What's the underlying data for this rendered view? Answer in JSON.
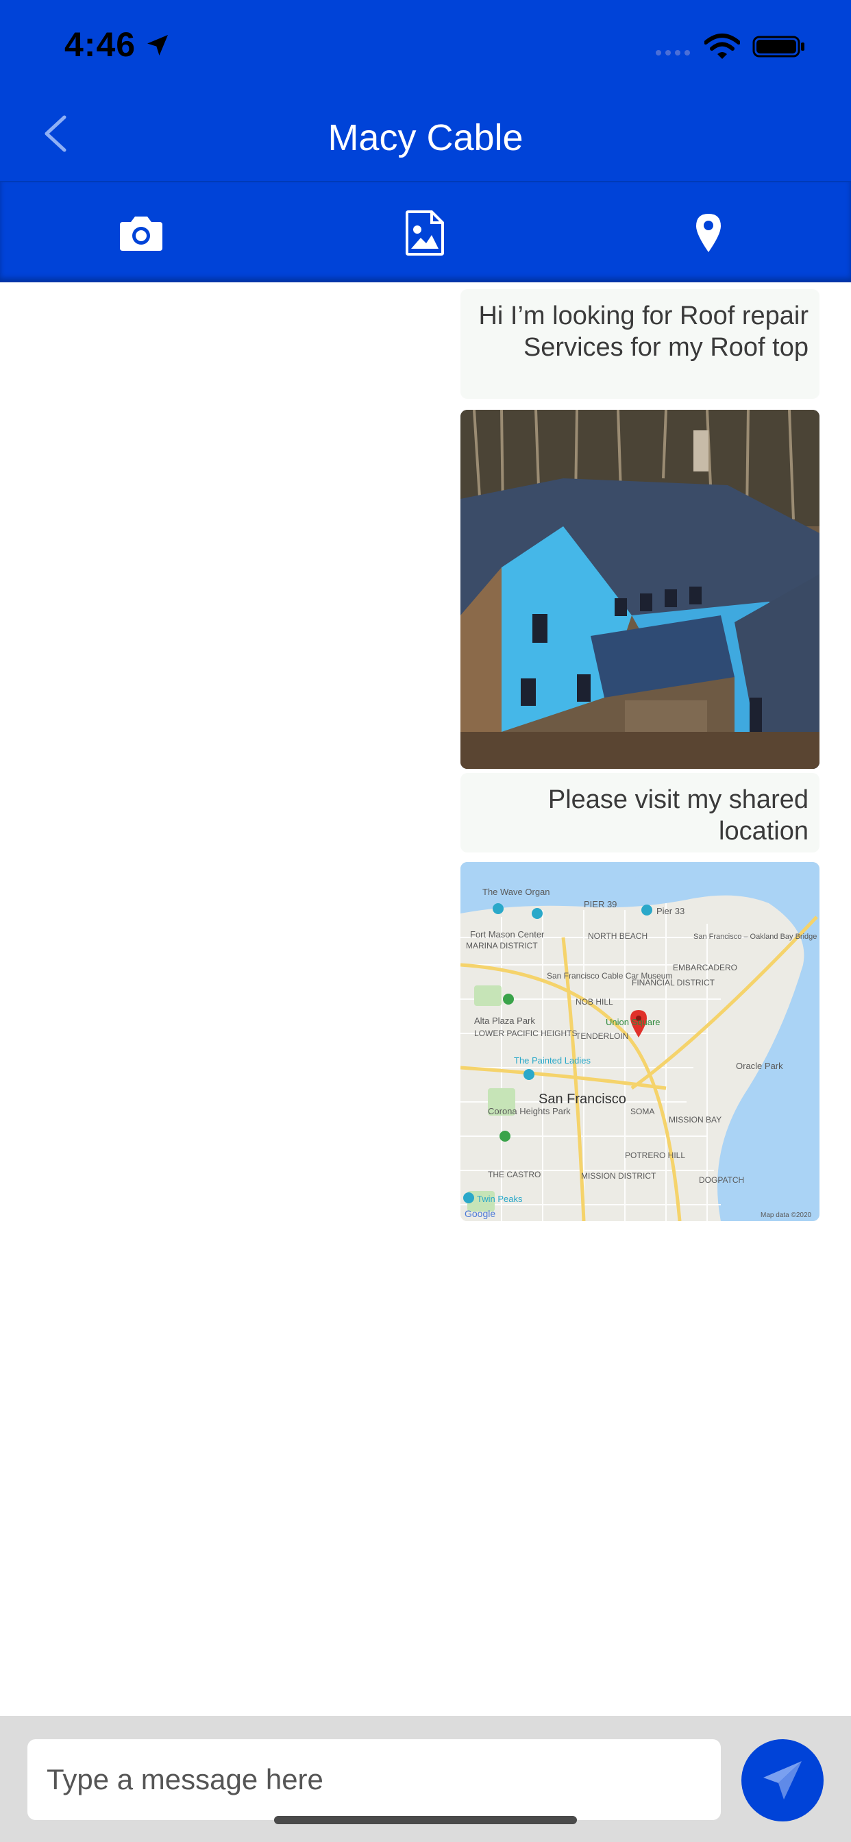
{
  "status_bar": {
    "time": "4:46"
  },
  "header": {
    "title": "Macy Cable",
    "back_label": "Back"
  },
  "toolbar": {
    "icons": [
      "camera-icon",
      "image-icon",
      "location-pin-icon"
    ]
  },
  "messages": [
    {
      "type": "text",
      "text": "Hi I’m looking for Roof repair Services for my Roof top"
    },
    {
      "type": "image",
      "alt": "photo"
    },
    {
      "type": "text",
      "text": "Please visit my shared location"
    },
    {
      "type": "map"
    }
  ],
  "map": {
    "labels": [
      "The Wave Organ",
      "PIER 39",
      "Pier 33",
      "Fort Mason Center",
      "MARINA DISTRICT",
      "NORTH BEACH",
      "San Francisco – Oakland Bay Bridge",
      "EMBARCADERO",
      "San Francisco Cable Car Museum",
      "FINANCIAL DISTRICT",
      "NOB HILL",
      "Alta Plaza Park",
      "LOWER PACIFIC HEIGHTS",
      "Union Square",
      "TENDERLOIN",
      "The Painted Ladies",
      "Oracle Park",
      "San Francisco",
      "Corona Heights Park",
      "SOMA",
      "MISSION BAY",
      "POTRERO HILL",
      "THE CASTRO",
      "MISSION DISTRICT",
      "DOGPATCH",
      "Twin Peaks",
      "Google",
      "Map data ©2020"
    ]
  },
  "composer": {
    "placeholder": "Type a message here"
  },
  "colors": {
    "brand": "#0043d8",
    "bubble": "#f6f9f6",
    "composer_bg": "#dcdcdc"
  }
}
